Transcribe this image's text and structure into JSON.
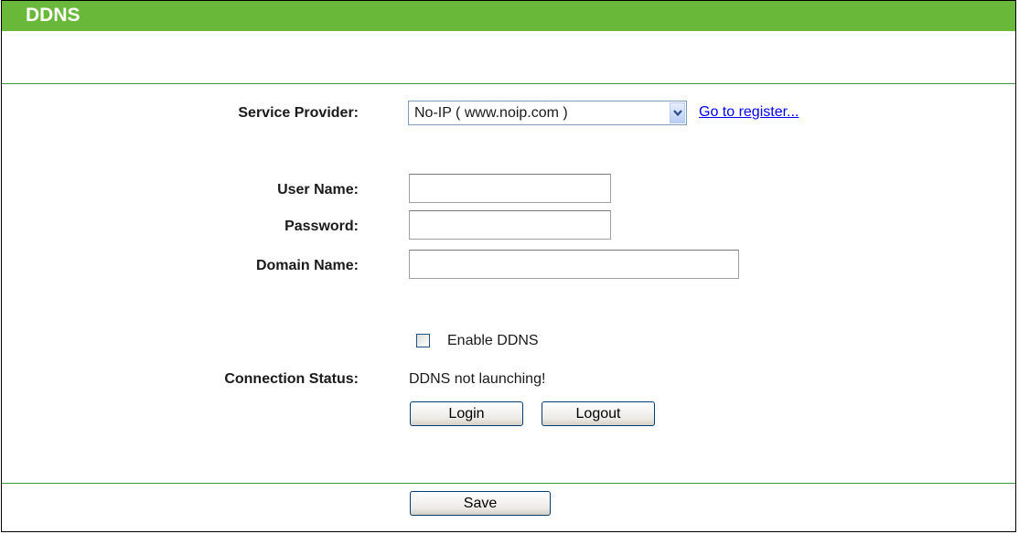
{
  "header": {
    "title": "DDNS"
  },
  "form": {
    "service_provider": {
      "label": "Service Provider:",
      "selected": "No-IP ( www.noip.com )",
      "register_link": "Go to register..."
    },
    "user_name": {
      "label": "User Name:",
      "value": ""
    },
    "password": {
      "label": "Password:",
      "value": ""
    },
    "domain_name": {
      "label": "Domain Name:",
      "value": ""
    },
    "enable_ddns": {
      "label": "Enable DDNS",
      "checked": false
    },
    "connection_status": {
      "label": "Connection Status:",
      "value": "DDNS not launching!"
    },
    "login_label": "Login",
    "logout_label": "Logout"
  },
  "footer": {
    "save_label": "Save"
  },
  "colors": {
    "header_bg": "#6ab83a",
    "divider": "#3a9a3a",
    "link": "#0000ee"
  },
  "icons": {
    "dropdown": "chevron-down-icon"
  }
}
